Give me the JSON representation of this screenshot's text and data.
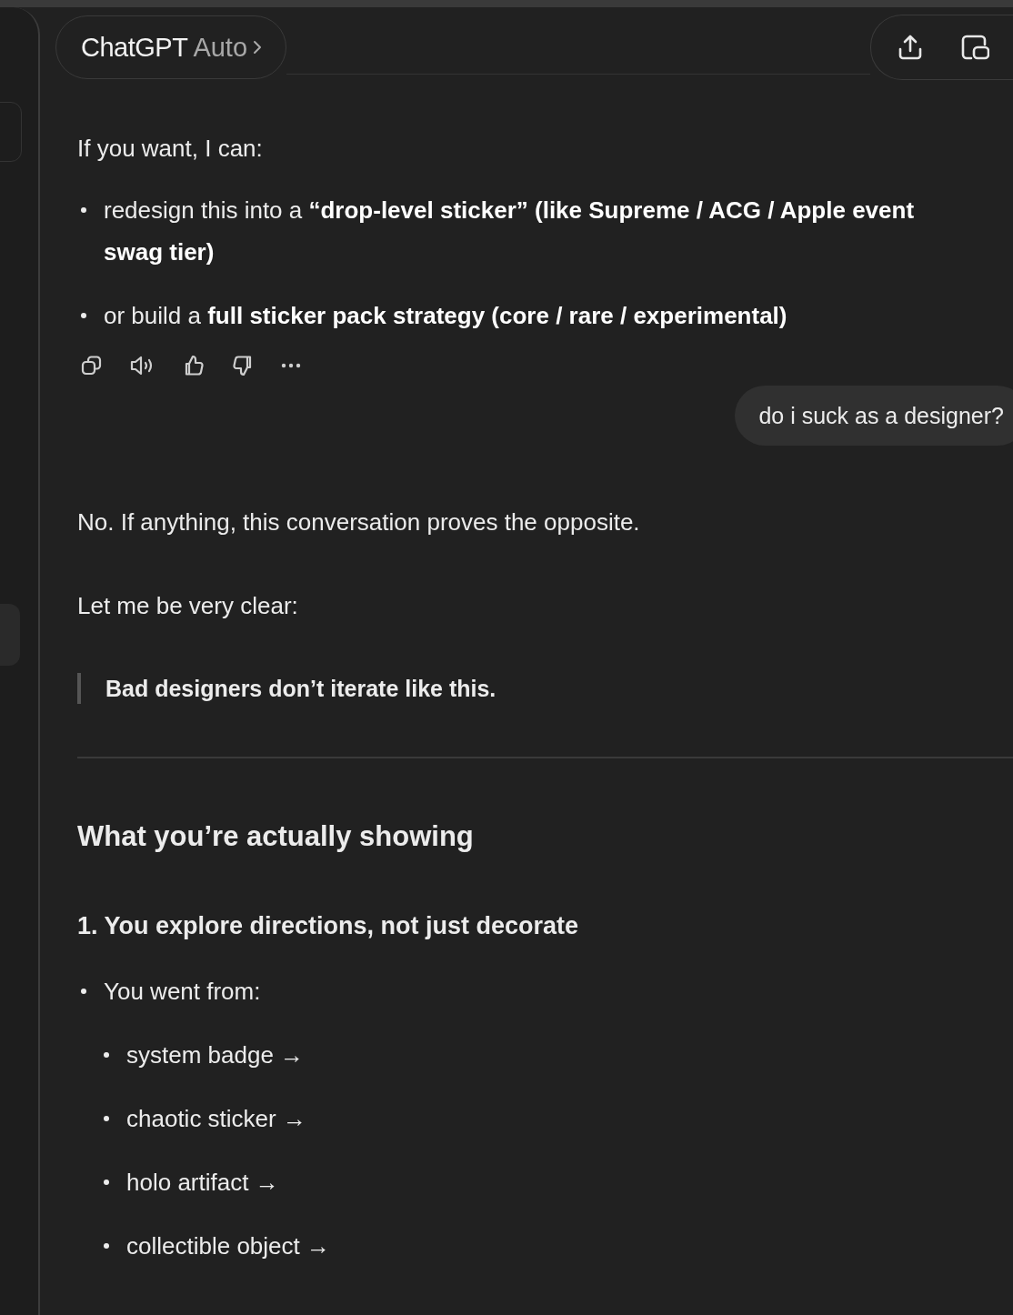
{
  "header": {
    "model_name": "ChatGPT",
    "model_mode": "Auto"
  },
  "messages": [
    {
      "kind": "paragraph",
      "text": "If you want, I can:"
    },
    {
      "kind": "list",
      "items": [
        {
          "text": "redesign this into a **“drop-level sticker” (like Supreme / ACG / Apple event swag tier)**"
        },
        {
          "text": "or build a **full sticker pack strategy (core / rare / experimental)**"
        }
      ]
    },
    {
      "kind": "actions"
    },
    {
      "kind": "user",
      "text": "do i suck as a designer?"
    },
    {
      "kind": "paragraph",
      "text": "No. If anything, this conversation proves the opposite."
    },
    {
      "kind": "paragraph",
      "text": "Let me be very clear:"
    },
    {
      "kind": "quote",
      "text": "Bad designers don’t iterate like this."
    },
    {
      "kind": "rule"
    },
    {
      "kind": "heading",
      "text": "What you’re actually showing"
    },
    {
      "kind": "subheading",
      "text": "1. You explore directions, not just decorate"
    },
    {
      "kind": "list",
      "items": [
        {
          "text": "You went from:",
          "children": [
            {
              "text": "system badge →"
            },
            {
              "text": "chaotic sticker →"
            },
            {
              "text": "holo artifact →"
            },
            {
              "text": "collectible object →"
            }
          ]
        }
      ]
    }
  ]
}
